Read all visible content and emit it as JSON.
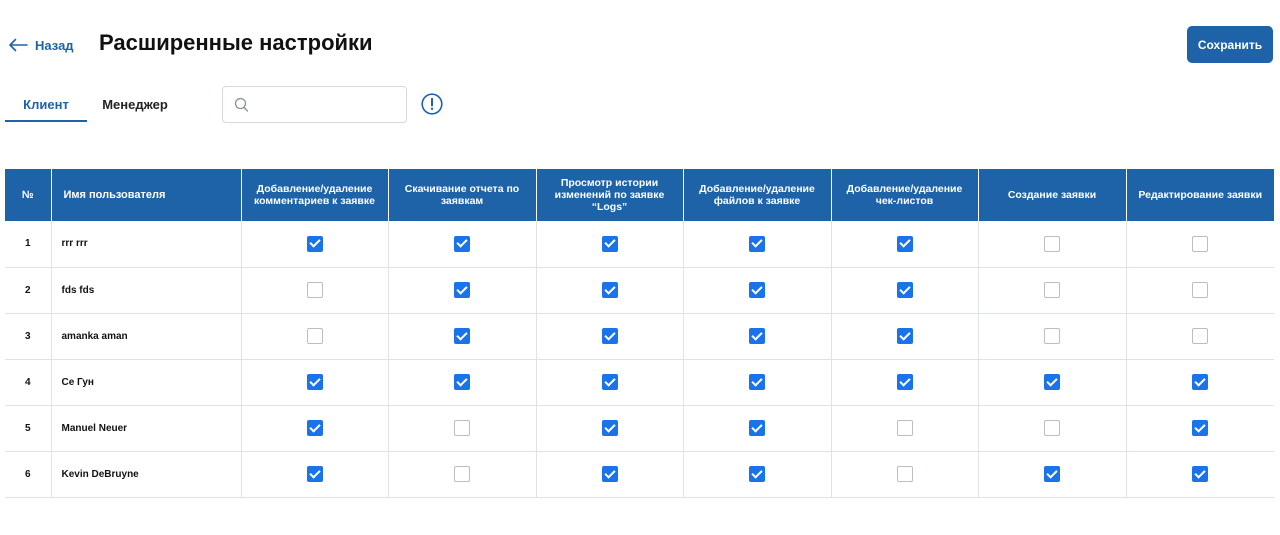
{
  "header": {
    "back_label": "Назад",
    "title": "Расширенные настройки",
    "save_label": "Сохранить"
  },
  "tabs": [
    {
      "label": "Клиент",
      "active": true
    },
    {
      "label": "Менеджер",
      "active": false
    }
  ],
  "search": {
    "placeholder": "",
    "value": ""
  },
  "table": {
    "columns": [
      "№",
      "Имя пользователя",
      "Добавление/удаление комментариев к заявке",
      "Скачивание отчета по заявкам",
      "Просмотр истории изменений по заявке “Logs”",
      "Добавление/удаление файлов к заявке",
      "Добавление/удаление чек-листов",
      "Создание заявки",
      "Редактирование заявки"
    ],
    "rows": [
      {
        "num": "1",
        "name": "rrr rrr",
        "perms": [
          true,
          true,
          true,
          true,
          true,
          false,
          false
        ]
      },
      {
        "num": "2",
        "name": "fds fds",
        "perms": [
          false,
          true,
          true,
          true,
          true,
          false,
          false
        ]
      },
      {
        "num": "3",
        "name": "amanka aman",
        "perms": [
          false,
          true,
          true,
          true,
          true,
          false,
          false
        ]
      },
      {
        "num": "4",
        "name": "Се Гун",
        "perms": [
          true,
          true,
          true,
          true,
          true,
          true,
          true
        ]
      },
      {
        "num": "5",
        "name": "Manuel Neuer",
        "perms": [
          true,
          false,
          true,
          true,
          false,
          false,
          true
        ]
      },
      {
        "num": "6",
        "name": "Kevin DeBruyne",
        "perms": [
          true,
          false,
          true,
          true,
          false,
          true,
          true
        ]
      }
    ]
  },
  "colors": {
    "accent": "#1e63a8",
    "checkbox": "#1a73e8",
    "border": "#dfe2e6"
  },
  "icons": {
    "back": "arrow-left-icon",
    "search": "search-icon",
    "info": "info-icon"
  }
}
